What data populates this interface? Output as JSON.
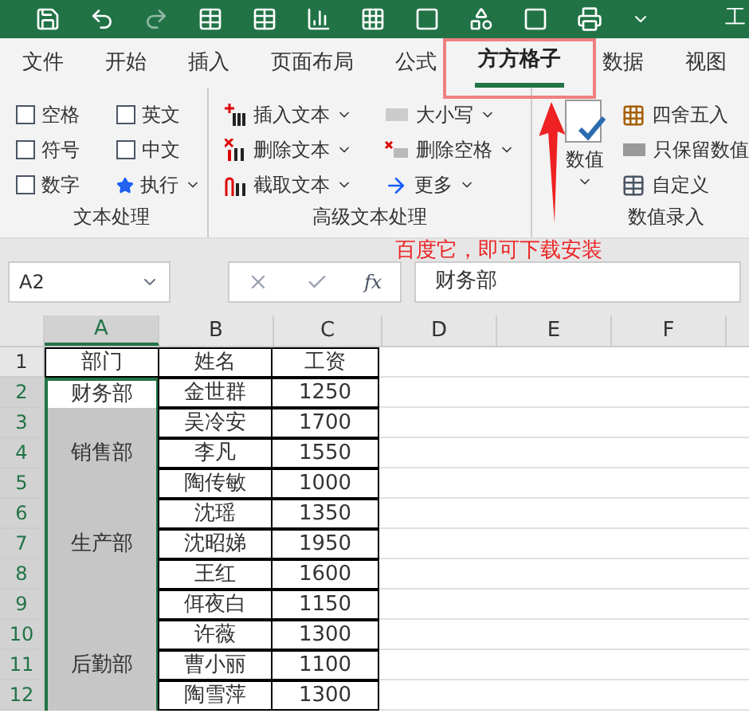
{
  "window": {
    "title": "工"
  },
  "tabs": [
    {
      "label": "文件",
      "selected": false
    },
    {
      "label": "开始",
      "selected": false
    },
    {
      "label": "插入",
      "selected": false
    },
    {
      "label": "页面布局",
      "selected": false
    },
    {
      "label": "公式",
      "selected": false
    },
    {
      "label": "方方格子",
      "selected": true
    },
    {
      "label": "数据",
      "selected": false
    },
    {
      "label": "视图",
      "selected": false
    }
  ],
  "ribbon": {
    "groups": [
      {
        "label": "文本处理",
        "checkboxes": [
          {
            "label": "空格",
            "checked": false
          },
          {
            "label": "英文",
            "checked": false
          },
          {
            "label": "符号",
            "checked": false
          },
          {
            "label": "中文",
            "checked": false
          },
          {
            "label": "数字",
            "checked": false
          }
        ],
        "run_button": "执行"
      },
      {
        "label": "高级文本处理",
        "commands": [
          {
            "label": "插入文本",
            "kind": "insert"
          },
          {
            "label": "大小写",
            "kind": "case"
          },
          {
            "label": "删除文本",
            "kind": "delete"
          },
          {
            "label": "删除空格",
            "kind": "space"
          },
          {
            "label": "截取文本",
            "kind": "extract"
          },
          {
            "label": "更多",
            "kind": "more"
          }
        ]
      },
      {
        "label": "数值录入",
        "big_button": "数值",
        "commands": [
          {
            "label": "四舍五入",
            "kind": "round"
          },
          {
            "label": "只保留数值",
            "kind": "keep"
          },
          {
            "label": "自定义",
            "kind": "custom"
          }
        ]
      }
    ]
  },
  "annotation": {
    "text": "百度它，即可下载安装"
  },
  "formula_bar": {
    "name_box": "A2",
    "fx": "fx",
    "value": "财务部"
  },
  "sheet": {
    "columns": [
      {
        "label": "A",
        "selected": true
      },
      {
        "label": "B",
        "selected": false
      },
      {
        "label": "C",
        "selected": false
      },
      {
        "label": "D",
        "selected": false
      },
      {
        "label": "E",
        "selected": false
      },
      {
        "label": "F",
        "selected": false
      }
    ],
    "rows": [
      {
        "number": "1",
        "dept": "部门",
        "name": "姓名",
        "salary": "工资",
        "selected": false,
        "active": false
      },
      {
        "number": "2",
        "dept": "财务部",
        "name": "金世群",
        "salary": "1250",
        "selected": true,
        "active": true
      },
      {
        "number": "3",
        "name": "吴冷安",
        "salary": "1700",
        "selected": true,
        "active": false
      },
      {
        "number": "4",
        "dept": "销售部",
        "name": "李凡",
        "salary": "1550",
        "selected": true,
        "active": false
      },
      {
        "number": "5",
        "name": "陶传敏",
        "salary": "1000",
        "selected": true,
        "active": false
      },
      {
        "number": "6",
        "name": "沈瑶",
        "salary": "1350",
        "selected": true,
        "active": false
      },
      {
        "number": "7",
        "dept": "生产部",
        "name": "沈昭娣",
        "salary": "1950",
        "selected": true,
        "active": false
      },
      {
        "number": "8",
        "name": "王红",
        "salary": "1600",
        "selected": true,
        "active": false
      },
      {
        "number": "9",
        "name": "佴夜白",
        "salary": "1150",
        "selected": true,
        "active": false
      },
      {
        "number": "10",
        "name": "许薇",
        "salary": "1300",
        "selected": true,
        "active": false
      },
      {
        "number": "11",
        "dept": "后勤部",
        "name": "曹小丽",
        "salary": "1100",
        "selected": true,
        "active": false
      },
      {
        "number": "12",
        "name": "陶雪萍",
        "salary": "1300",
        "selected": true,
        "active": false
      }
    ]
  }
}
